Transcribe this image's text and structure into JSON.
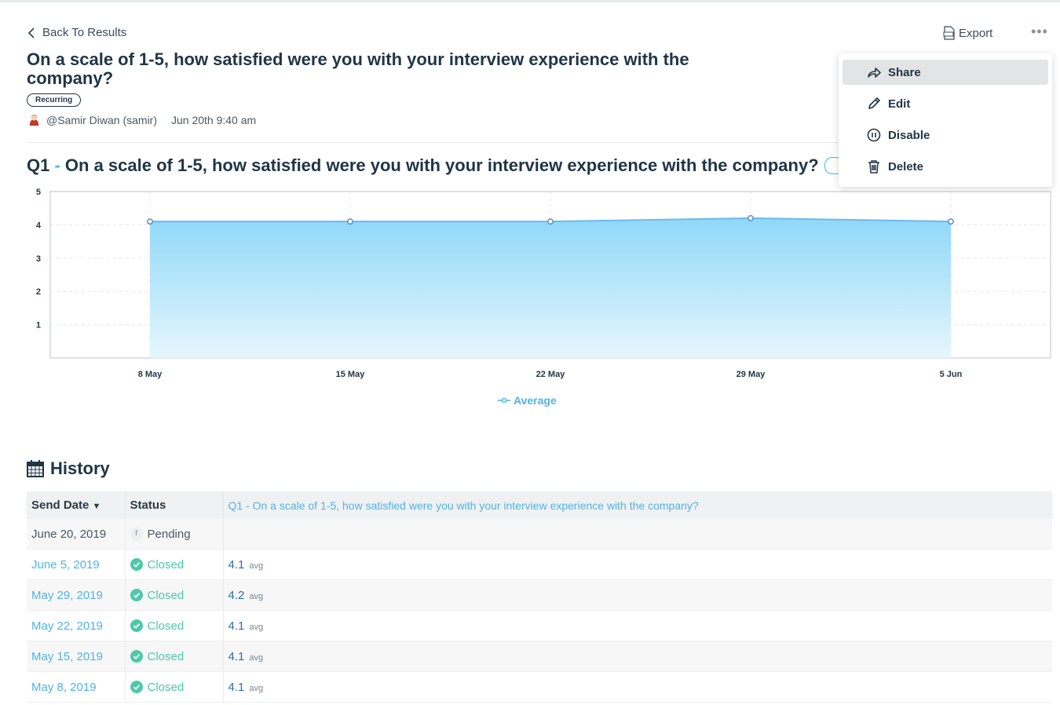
{
  "header": {
    "back_label": "Back To Results",
    "export_label": "Export",
    "more_label": "•••"
  },
  "survey": {
    "title": "On a scale of 1-5, how satisfied were you with your interview experience with the company?",
    "badge": "Recurring",
    "author": "@Samir Diwan (samir)",
    "date": "Jun 20th 9:40 am"
  },
  "question": {
    "number": "Q1",
    "separator": " - ",
    "text": "On a scale of 1-5, how satisfied were you with your interview experience with the company?"
  },
  "menu": {
    "items": [
      {
        "label": "Share",
        "icon": "share-icon",
        "active": true
      },
      {
        "label": "Edit",
        "icon": "pencil-icon"
      },
      {
        "label": "Disable",
        "icon": "pause-icon"
      },
      {
        "label": "Delete",
        "icon": "trash-icon"
      }
    ]
  },
  "chart_data": {
    "type": "area",
    "categories": [
      "8 May",
      "15 May",
      "22 May",
      "29 May",
      "5 Jun"
    ],
    "series": [
      {
        "name": "Average",
        "values": [
          4.1,
          4.1,
          4.1,
          4.2,
          4.1
        ]
      }
    ],
    "ylim": [
      0,
      5
    ],
    "yticks": [
      "1",
      "2",
      "3",
      "4",
      "5"
    ],
    "grid": true,
    "legend_position": "bottom",
    "colors": {
      "line": "#6cb8ef",
      "fill_top": "#8fd8f8",
      "fill_bottom": "#e6f6fd"
    }
  },
  "history": {
    "title": "History",
    "columns": [
      "Send Date",
      "Status",
      "Q1 - On a scale of 1-5, how satisfied were you with your interview experience with the company?"
    ],
    "rows": [
      {
        "date": "June 20, 2019",
        "status": "Pending",
        "value": "",
        "unit": ""
      },
      {
        "date": "June 5, 2019",
        "status": "Closed",
        "value": "4.1",
        "unit": "avg"
      },
      {
        "date": "May 29, 2019",
        "status": "Closed",
        "value": "4.2",
        "unit": "avg"
      },
      {
        "date": "May 22, 2019",
        "status": "Closed",
        "value": "4.1",
        "unit": "avg"
      },
      {
        "date": "May 15, 2019",
        "status": "Closed",
        "value": "4.1",
        "unit": "avg"
      },
      {
        "date": "May 8, 2019",
        "status": "Closed",
        "value": "4.1",
        "unit": "avg"
      }
    ]
  },
  "colors": {
    "accent": "#4fb3e8",
    "success": "#4cc9a8",
    "text": "#1f3546"
  }
}
